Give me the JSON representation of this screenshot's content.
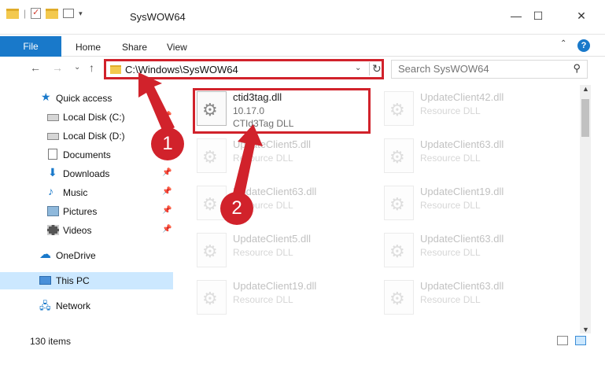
{
  "window": {
    "title": "SysWOW64",
    "minimize": "—",
    "maximize": "☐",
    "close": "✕"
  },
  "ribbon": {
    "tabs": [
      "File",
      "Home",
      "Share",
      "View"
    ],
    "help": "?",
    "collapse": "⌃"
  },
  "nav": {
    "back": "←",
    "forward": "→",
    "recent": "⌄",
    "up": "↑",
    "address": "C:\\Windows\\SysWOW64",
    "dropdown": "⌄",
    "refresh": "↻",
    "search_placeholder": "Search SysWOW64"
  },
  "sidebar": {
    "items": [
      {
        "label": "Quick access",
        "pinned": false
      },
      {
        "label": "Local Disk (C:)",
        "pinned": true
      },
      {
        "label": "Local Disk (D:)",
        "pinned": true
      },
      {
        "label": "Documents",
        "pinned": true
      },
      {
        "label": "Downloads",
        "pinned": true
      },
      {
        "label": "Music",
        "pinned": true
      },
      {
        "label": "Pictures",
        "pinned": true
      },
      {
        "label": "Videos",
        "pinned": true
      },
      {
        "label": "OneDrive",
        "pinned": false
      },
      {
        "label": "This PC",
        "pinned": false,
        "selected": true
      },
      {
        "label": "Network",
        "pinned": false
      }
    ]
  },
  "files": {
    "main": {
      "name": "ctid3tag.dll",
      "version": "10.17.0",
      "description": "CTId3Tag DLL"
    },
    "others": [
      {
        "name": "UpdateClient42.dll",
        "description": "Resource DLL"
      },
      {
        "name": "UpdateClient5.dll",
        "description": "Resource DLL"
      },
      {
        "name": "UpdateClient63.dll",
        "description": "Resource DLL"
      },
      {
        "name": "UpdateClient63.dll",
        "description": "Resource DLL"
      },
      {
        "name": "UpdateClient19.dll",
        "description": "Resource DLL"
      },
      {
        "name": "UpdateClient5.dll",
        "description": "Resource DLL"
      },
      {
        "name": "UpdateClient63.dll",
        "description": "Resource DLL"
      },
      {
        "name": "UpdateClient19.dll",
        "description": "Resource DLL"
      },
      {
        "name": "UpdateClient63.dll",
        "description": "Resource DLL"
      }
    ]
  },
  "status": {
    "count": "130 items"
  },
  "callouts": [
    "1",
    "2"
  ],
  "colors": {
    "accent": "#1979ca",
    "highlight": "#d1222b",
    "selection": "#cce8ff"
  }
}
